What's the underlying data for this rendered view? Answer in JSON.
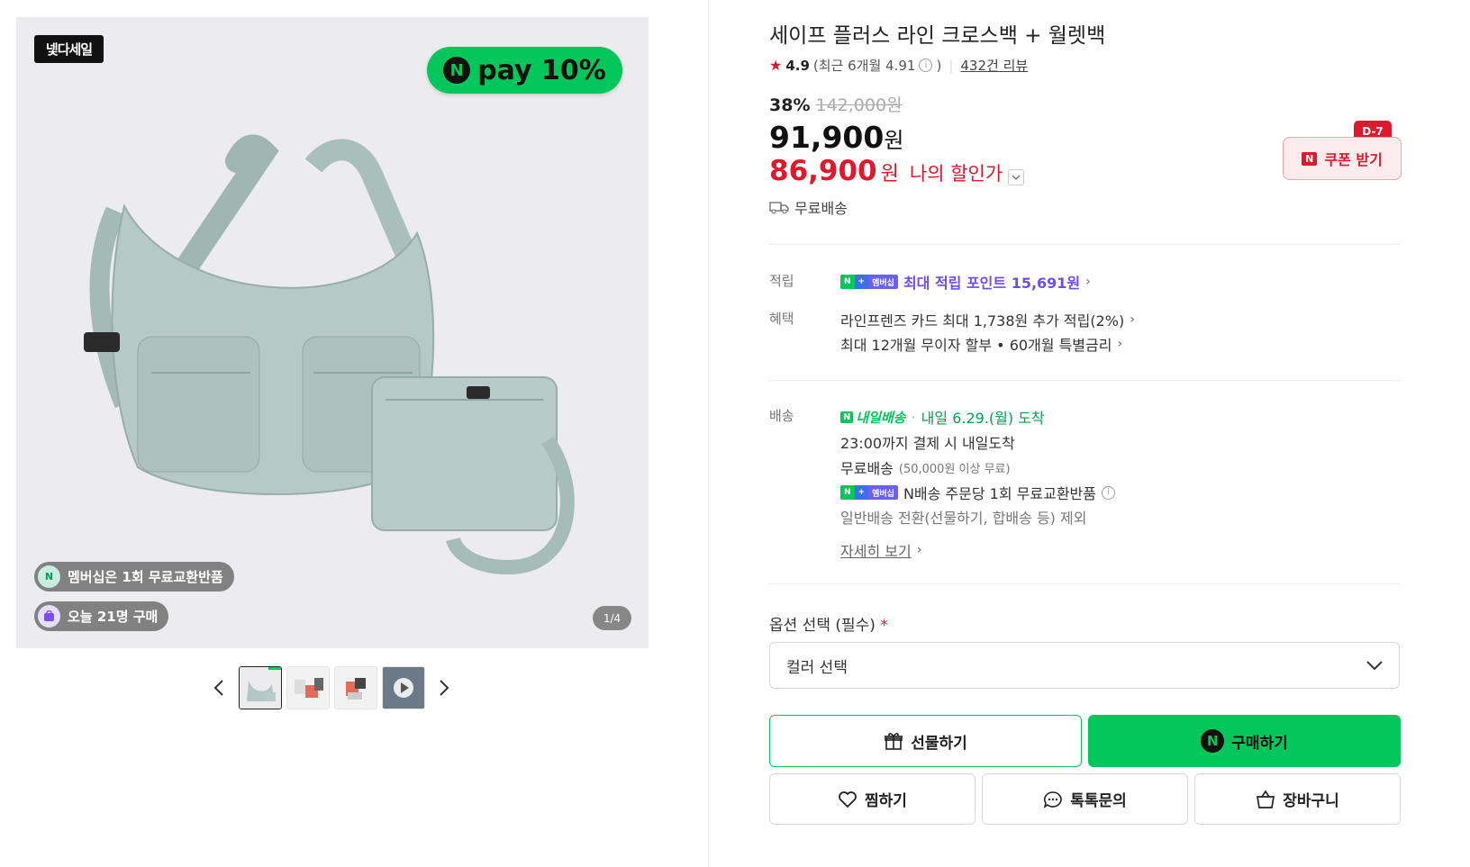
{
  "gallery": {
    "sale_badge": "넻다세일",
    "npay_text": "pay 10%",
    "npay_n": "N",
    "membership_pill": "멤버십은 1회 무료교환반품",
    "today_pill": "오늘 21명 구매",
    "pager": "1/4",
    "thumbnail_count": 4
  },
  "product": {
    "title": "세이프 플러스 라인 크로스백 + 월렛백",
    "rating": "4.9",
    "rating_recent": "(최근 6개월 4.91",
    "rating_close": ")",
    "reviews": "432건 리뷰",
    "discount_pct": "38%",
    "original_price": "142,000원",
    "price": "91,900",
    "price_unit": "원",
    "my_price": "86,900",
    "my_price_unit": "원",
    "my_price_label": "나의 할인가",
    "shipping": "무료배송",
    "coupon_label": "쿠폰 받기",
    "coupon_dday": "D-7"
  },
  "benefits": {
    "points_label": "적립",
    "points_text": "최대 적립 포인트 15,691원",
    "benefit_label": "혜택",
    "card_text": "라인프렌즈 카드 최대 1,738원 추가 적립(2%)",
    "installment_text": "최대 12개월 무이자 할부 • 60개월 특별금리",
    "membership_tag": "멤버십"
  },
  "delivery": {
    "label": "배송",
    "badge": "내일배송",
    "arrival": "내일 6.29.(월) 도착",
    "cutoff": "23:00까지 결제 시 내일도착",
    "free": "무료배송",
    "free_note": "(50,000원 이상 무료)",
    "nship": "N배송 주문당 1회 무료교환반품",
    "exclude": "일반배송 전환(선물하기, 합배송 등) 제외",
    "more": "자세히 보기"
  },
  "options": {
    "label": "옵션 선택 (필수)",
    "required": "*",
    "placeholder": "컬러 선택"
  },
  "actions": {
    "gift": "선물하기",
    "buy": "구매하기",
    "wish": "찜하기",
    "talk": "톡톡문의",
    "cart": "장바구니"
  },
  "colors": {
    "brand_green": "#03c75a",
    "discount_red": "#e0182d"
  }
}
